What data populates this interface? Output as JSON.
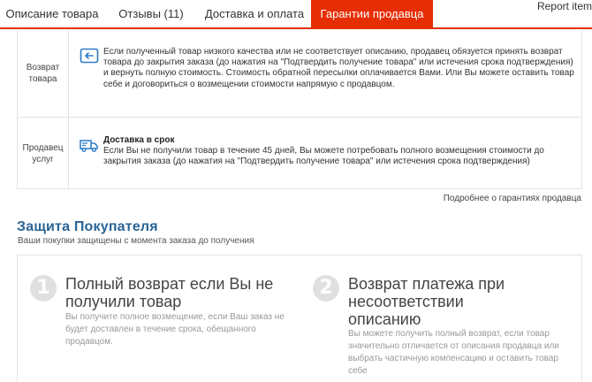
{
  "tabs": [
    {
      "label": "Описание товара"
    },
    {
      "label": "Отзывы (11)"
    },
    {
      "label": "Доставка и оплата"
    },
    {
      "label": "Гарантии продавца"
    }
  ],
  "report_label": "Report item",
  "guarantees": [
    {
      "label": "Возврат товара",
      "icon": "return-icon",
      "text": "Если полученный товар низкого качества или не соответствует описанию, продавец обязуется принять возврат товара до закрытия заказа (до нажатия на \"Подтвердить получение товара\" или истечения срока подтверждения) и вернуть полную стоимость. Стоимость обратной пересылки оплачивается Вами. Или Вы можете оставить товар себе и договориться о возмещении стоимости напрямую с продавцом."
    },
    {
      "label": "Продавец услуг",
      "icon": "delivery-truck-icon",
      "title": "Доставка в срок",
      "text": "Если Вы не получили товар в течение 45 дней, Вы можете потребовать полного возмещения стоимости до закрытия заказа (до нажатия на \"Подтвердить получение товара\" или истечения срока подтверждения)"
    }
  ],
  "more_link": "Подробнее о гарантиях продавца",
  "buyer_protection": {
    "title": "Защита Покупателя",
    "subtitle": "Ваши покупки защищены с момента заказа до получения",
    "cards": [
      {
        "number": "1",
        "title": "Полный возврат если Вы не получили товар",
        "desc": "Вы получите полное возмещение, если Ваш заказ не будет доставлен в течение срока, обещанного продавцом."
      },
      {
        "number": "2",
        "title": "Возврат платежа при несоответствии описанию",
        "desc": "Вы можете получить полный возврат, если товар значительно отличается от описания продавца или выбрать частичную компенсацию и оставить товар себе"
      }
    ]
  },
  "colors": {
    "accent": "#e62e04",
    "title_blue": "#2a6496",
    "icon_blue": "#2b7bc6"
  }
}
